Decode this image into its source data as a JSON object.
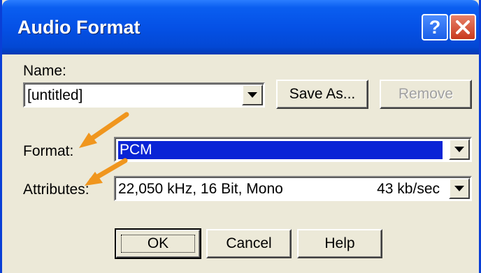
{
  "window": {
    "title": "Audio Format"
  },
  "titlebar_buttons": {
    "help_glyph": "?",
    "close_icon": "close-icon"
  },
  "name_section": {
    "label": "Name:",
    "value": "[untitled]",
    "save_as_label": "Save As...",
    "remove_label": "Remove"
  },
  "format_section": {
    "label": "Format:",
    "value": "PCM"
  },
  "attributes_section": {
    "label": "Attributes:",
    "value": "22,050 kHz, 16 Bit, Mono",
    "rate": "43 kb/sec"
  },
  "buttons": {
    "ok_label": "OK",
    "cancel_label": "Cancel",
    "help_label": "Help"
  },
  "colors": {
    "titlebar": "#0551e6",
    "dialog_bg": "#ece9d8",
    "selection": "#0a24d6",
    "callout_arrow": "#f0961e"
  }
}
